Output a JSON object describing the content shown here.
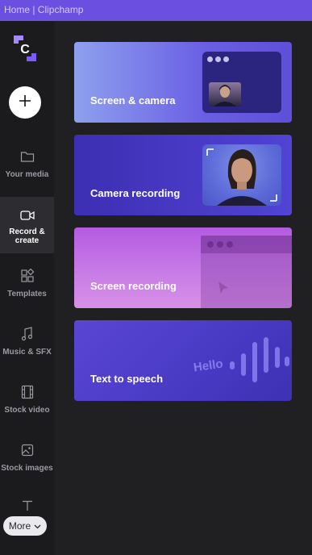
{
  "window": {
    "title": "Home | Clipchamp"
  },
  "sidebar": {
    "add_button_icon": "plus-icon",
    "items": [
      {
        "label": "Your media",
        "icon": "folder-icon",
        "active": false
      },
      {
        "label": "Record & create",
        "icon": "camera-icon",
        "active": true
      },
      {
        "label": "Templates",
        "icon": "templates-icon",
        "active": false
      },
      {
        "label": "Music & SFX",
        "icon": "music-note-icon",
        "active": false
      },
      {
        "label": "Stock video",
        "icon": "film-icon",
        "active": false
      },
      {
        "label": "Stock images",
        "icon": "image-icon",
        "active": false
      },
      {
        "label": "",
        "icon": "text-icon",
        "active": false
      }
    ],
    "more_label": "More"
  },
  "cards": [
    {
      "label": "Screen & camera"
    },
    {
      "label": "Camera recording"
    },
    {
      "label": "Screen recording"
    },
    {
      "label": "Text to speech",
      "decoration_text": "Hello"
    }
  ],
  "colors": {
    "accent": "#6a4fe0",
    "sidebar_bg": "#1b1b1d",
    "content_bg": "#202022"
  }
}
